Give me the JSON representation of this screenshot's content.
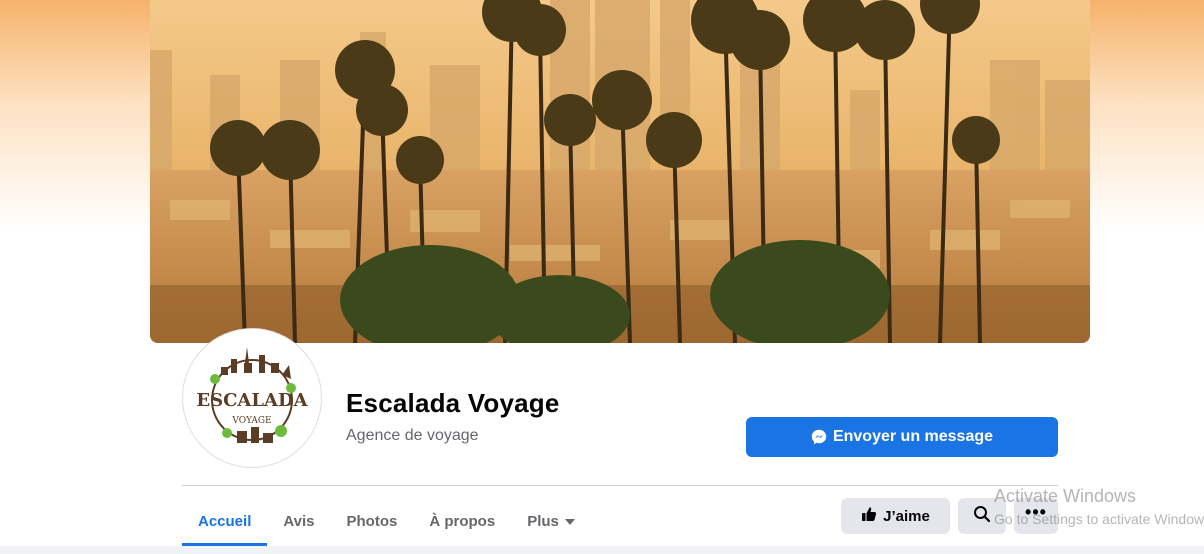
{
  "page": {
    "name": "Escalada Voyage",
    "category": "Agence de voyage"
  },
  "avatar": {
    "logo_text": "ESCALADA",
    "logo_subtext": "VOYAGE"
  },
  "actions": {
    "message_label": "Envoyer un message",
    "like_label": "J’aime"
  },
  "tabs": [
    {
      "label": "Accueil",
      "active": true
    },
    {
      "label": "Avis",
      "active": false
    },
    {
      "label": "Photos",
      "active": false
    },
    {
      "label": "À propos",
      "active": false
    },
    {
      "label": "Plus",
      "active": false
    }
  ],
  "watermark": {
    "title": "Activate Windows",
    "subtitle": "Go to Settings to activate Windows."
  },
  "icons": {
    "messenger": "messenger-icon",
    "like": "thumbs-up-icon",
    "search": "search-icon",
    "more": "more-icon",
    "dropdown": "caret-down-icon"
  },
  "colors": {
    "accent": "#1b74e4",
    "button_gray": "#e4e6eb",
    "text_primary": "#050505",
    "text_secondary": "#65676b"
  }
}
